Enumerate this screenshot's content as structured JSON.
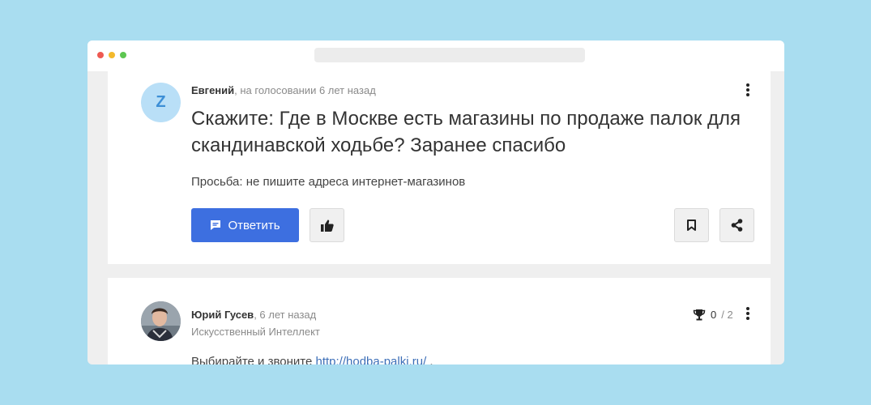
{
  "question": {
    "avatar_letter": "Z",
    "author": "Евгений",
    "meta_suffix": ", на голосовании 6 лет назад",
    "title": "Скажите: Где в Москве есть магазины по продаже палок для скандинавской ходьбе? Заранее спасибо",
    "body": "Просьба: не пишите адреса интернет-магазинов",
    "reply_label": "Ответить"
  },
  "answer": {
    "author": "Юрий Гусев",
    "meta_suffix": ", 6 лет назад",
    "subtitle": "Искусственный Интеллект",
    "score_value": "0",
    "score_total": "/ 2",
    "body_prefix": "Выбирайте и звоните ",
    "link_text": "http://hodba-palki.ru/",
    "body_suffix": " ."
  },
  "icons": {
    "reply": "chat-bubble-icon",
    "like": "thumbs-up-icon",
    "bookmark": "bookmark-icon",
    "share": "share-icon",
    "menu": "more-vertical-icon",
    "score": "trophy-icon"
  },
  "colors": {
    "page_background": "#a9ddf0",
    "primary_button": "#3d6fe0",
    "link": "#3d6fb8",
    "avatar_background": "#b9dff7"
  }
}
